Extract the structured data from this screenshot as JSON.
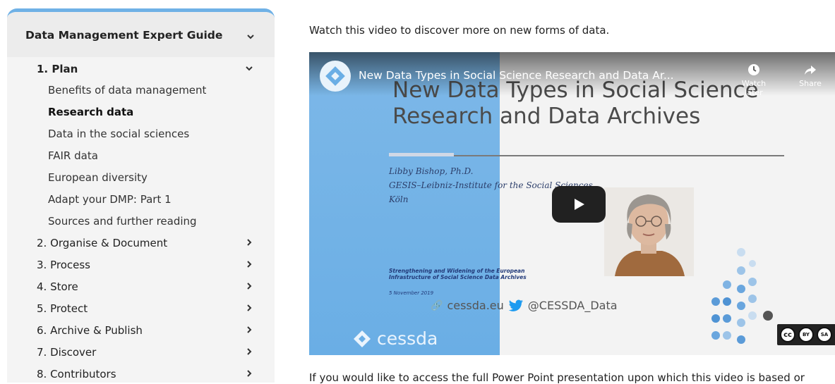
{
  "sidebar": {
    "guide_title": "Data Management Expert Guide",
    "sections": [
      {
        "label": "1. Plan",
        "open": true
      },
      {
        "label": "2. Organise & Document"
      },
      {
        "label": "3. Process"
      },
      {
        "label": "4. Store"
      },
      {
        "label": "5. Protect"
      },
      {
        "label": "6. Archive & Publish"
      },
      {
        "label": "7. Discover"
      },
      {
        "label": "8. Contributors"
      }
    ],
    "plan_items": [
      {
        "label": "Benefits of data management"
      },
      {
        "label": "Research data",
        "active": true
      },
      {
        "label": "Data in the social sciences"
      },
      {
        "label": "FAIR data"
      },
      {
        "label": "European diversity"
      },
      {
        "label": "Adapt your DMP: Part 1"
      },
      {
        "label": "Sources and further reading"
      }
    ]
  },
  "main": {
    "intro": "Watch this video to discover more on new forms of data.",
    "video": {
      "yt_title": "New Data Types in Social Science Research and Data Ar...",
      "watch_later": "Watch later",
      "share": "Share",
      "slide": {
        "title_line1": "New Data Types in Social Science",
        "title_line2": "Research and Data Archives",
        "speaker_name": "Libby Bishop, Ph.D.",
        "speaker_org": "GESIS–Leibniz-Institute for the Social Sciences",
        "speaker_city": "Köln",
        "project_line1": "Strengthening and Widening of the European",
        "project_line2": "Infrastructure of Social Science Data Archives",
        "date": "5 November 2019",
        "website": "cessda.eu",
        "twitter": "@CESSDA_Data",
        "logo_text": "cessda"
      },
      "license": {
        "by": "BY",
        "sa": "SA"
      }
    },
    "cut_text": "If you would like to access the full Power Point presentation upon which this video is based or"
  },
  "colors": {
    "accent": "#6fb1e6",
    "slide_blue": "#7db8e8",
    "yt_play": "#212121"
  }
}
